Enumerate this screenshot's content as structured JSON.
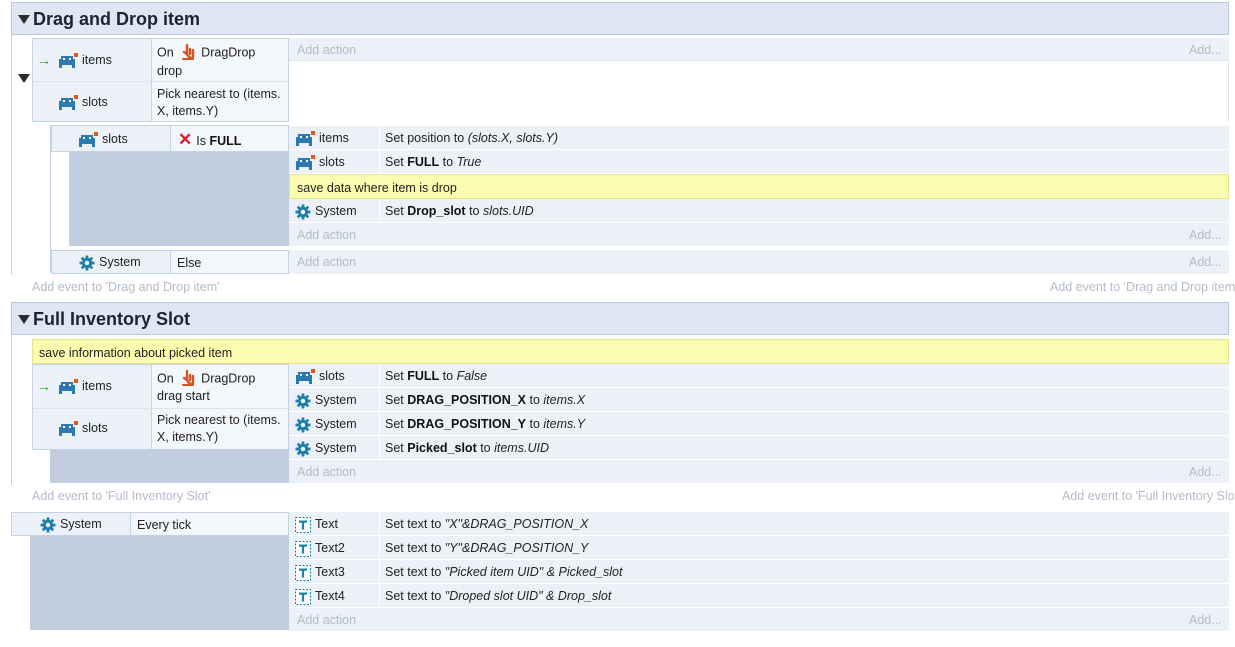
{
  "groups": [
    {
      "title": "Drag and Drop item",
      "add_event": "Add event to 'Drag and Drop item'",
      "add_event_right": "Add event to 'Drag and Drop item'..."
    },
    {
      "title": "Full Inventory Slot",
      "add_event": "Add event to 'Full Inventory Slot'",
      "add_event_right": "Add event to 'Full Inventory Slot'..."
    }
  ],
  "add_action": "Add action",
  "add_ellipsis": "Add...",
  "event1": {
    "conditions": [
      {
        "object": "items",
        "text_a": "On",
        "plugin": "DragDrop",
        "text_b": "drop"
      },
      {
        "object": "slots",
        "line1": "Pick nearest to (items.",
        "line2": "X, items.Y)"
      }
    ]
  },
  "sub1": {
    "condition": {
      "object": "slots",
      "prefix": "Is",
      "bold": "FULL"
    },
    "actions": [
      {
        "object": "items",
        "pre": "Set position to ",
        "italic": "(slots.X, slots.Y)"
      },
      {
        "object": "slots",
        "pre": "Set ",
        "bold": "FULL",
        "mid": " to ",
        "italic": "True"
      }
    ],
    "comment": "save data where item is drop",
    "action3": {
      "object": "System",
      "pre": "Set ",
      "bold": "Drop_slot",
      "mid": " to ",
      "italic": "slots.UID"
    }
  },
  "sub2": {
    "object": "System",
    "text": "Else"
  },
  "event2": {
    "comment": "save information about picked item",
    "conditions": [
      {
        "object": "items",
        "text_a": "On",
        "plugin": "DragDrop",
        "text_b": "drag start"
      },
      {
        "object": "slots",
        "line1": "Pick nearest to (items.",
        "line2": "X, items.Y)"
      }
    ],
    "actions": [
      {
        "object": "slots",
        "pre": "Set ",
        "bold": "FULL",
        "mid": " to ",
        "italic": "False"
      },
      {
        "object": "System",
        "pre": "Set ",
        "bold": "DRAG_POSITION_X",
        "mid": " to ",
        "italic": "items.X"
      },
      {
        "object": "System",
        "pre": "Set ",
        "bold": "DRAG_POSITION_Y",
        "mid": " to ",
        "italic": "items.Y"
      },
      {
        "object": "System",
        "pre": "Set ",
        "bold": "Picked_slot",
        "mid": " to ",
        "italic": "items.UID"
      }
    ]
  },
  "event3": {
    "condition": {
      "object": "System",
      "text": "Every tick"
    },
    "actions": [
      {
        "object": "Text",
        "pre": "Set text to ",
        "italic": "\"X\"&DRAG_POSITION_X"
      },
      {
        "object": "Text2",
        "pre": "Set text to ",
        "italic": "\"Y\"&DRAG_POSITION_Y"
      },
      {
        "object": "Text3",
        "pre": "Set text to ",
        "italic": "\"Picked item UID\" & Picked_slot"
      },
      {
        "object": "Text4",
        "pre": "Set text to ",
        "italic": "\"Droped slot UID\" & Drop_slot"
      }
    ]
  },
  "colors": {
    "group_bg": "#dfe7f3",
    "comment_bg": "#fcfcb0",
    "system_icon": "#1f7fa8",
    "sprite_icon": "#2a7ab0",
    "dragdrop_icon": "#d9531e"
  }
}
